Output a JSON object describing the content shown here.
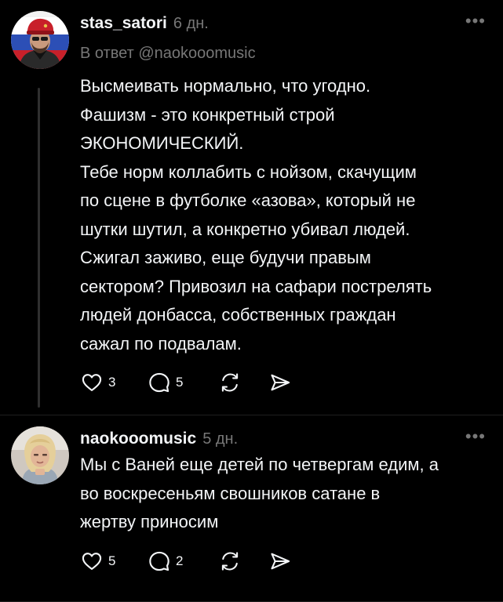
{
  "colors": {
    "background": "#000000",
    "text_primary": "#f3f5f7",
    "text_secondary": "#777777",
    "thread_line": "#2f2f2f"
  },
  "posts": [
    {
      "username": "stas_satori",
      "time": "6 дн.",
      "reply_to": "В ответ @naokooomusic",
      "body_lines": [
        "Высмеивать нормально, что угодно.",
        "Фашизм - это конкретный строй",
        "ЭКОНОМИЧЕСКИЙ.",
        "Тебе норм коллабить с нойзом, скачущим",
        "по сцене в футболке «азова», который не",
        "шутки шутил, а конкретно убивал людей.",
        "Сжигал заживо, еще будучи правым",
        "сектором? Привозил на сафари пострелять",
        "людей донбасса, собственных граждан",
        "сажал по подвалам."
      ],
      "likes": "3",
      "comments": "5",
      "icons": {
        "avatar": "avatar-man-red-beret",
        "more": "more-icon",
        "like": "heart-icon",
        "comment": "comment-icon",
        "repost": "repost-icon",
        "share": "share-icon"
      }
    },
    {
      "username": "naokooomusic",
      "time": "5 дн.",
      "body_lines": [
        "Мы с Ваней еще детей по четвергам едим, а",
        "во воскресеньям свошников сатане в",
        "жертву приносим"
      ],
      "likes": "5",
      "comments": "2",
      "icons": {
        "avatar": "avatar-woman-blonde",
        "more": "more-icon",
        "like": "heart-icon",
        "comment": "comment-icon",
        "repost": "repost-icon",
        "share": "share-icon"
      }
    }
  ]
}
